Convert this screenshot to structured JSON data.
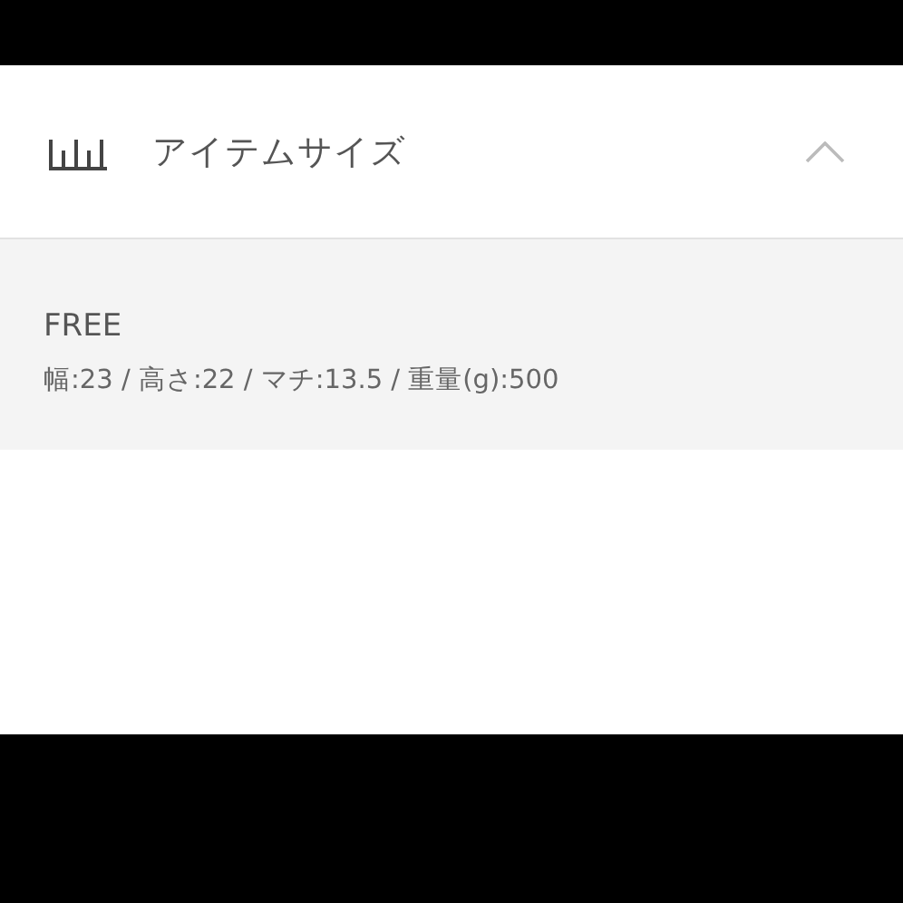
{
  "section": {
    "title": "アイテムサイズ",
    "expanded": true
  },
  "size": {
    "name": "FREE",
    "details": "幅:23 / 高さ:22 / マチ:13.5 / 重量(g):500"
  }
}
